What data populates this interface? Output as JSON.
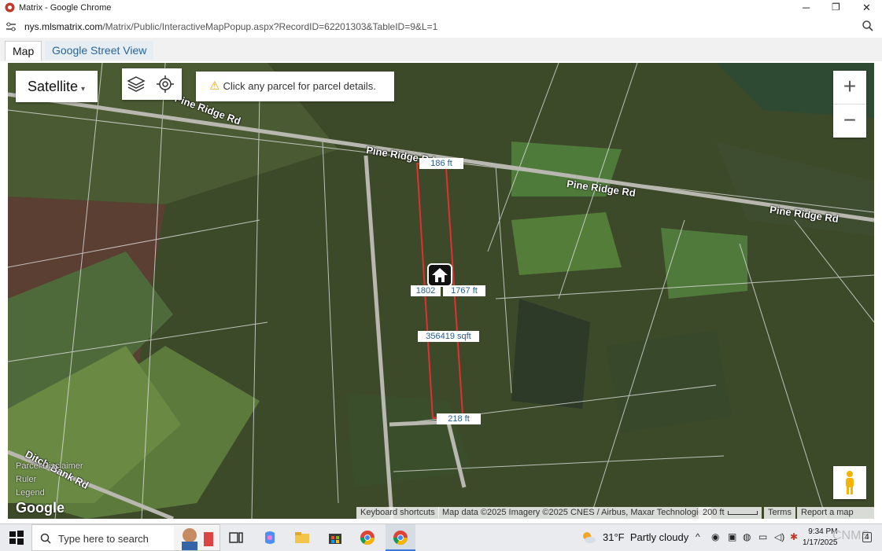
{
  "window": {
    "title": "Matrix - Google Chrome",
    "minimize": "─",
    "maximize": "❐",
    "close": "✕"
  },
  "address": {
    "host": "nys.mlsmatrix.com",
    "path": "/Matrix/Public/InteractiveMapPopup.aspx?RecordID=62201303&TableID=9&L=1"
  },
  "tabs": [
    {
      "label": "Map",
      "active": true
    },
    {
      "label": "Google Street View",
      "active": false
    }
  ],
  "map": {
    "type_control": {
      "label": "Satellite",
      "caret": "▾"
    },
    "notice": {
      "icon": "warning-icon",
      "text": "Click any parcel for parcel details."
    },
    "zoom": {
      "in": "+",
      "out": "−"
    },
    "roads": [
      "Pine Ridge Rd",
      "Pine Ridge Rd",
      "Pine Ridge Rd",
      "Ditch Bank Rd"
    ],
    "dimension_labels": {
      "top": "186 ft",
      "left_side": "1802",
      "right_side": "1767 ft",
      "area": "356419 sqft",
      "bottom": "218 ft"
    },
    "side_links": [
      "Parcel Disclaimer",
      "Ruler",
      "Legend"
    ],
    "google_logo": "Google",
    "attribution": {
      "shortcuts": "Keyboard shortcuts",
      "data": "Map data ©2025 Imagery ©2025 CNES / Airbus, Maxar Technologies",
      "scale": "200 ft",
      "terms": "Terms",
      "report": "Report a map error"
    }
  },
  "taskbar": {
    "search_placeholder": "Type here to search",
    "weather": {
      "temp": "31°F",
      "condition": "Partly cloudy"
    },
    "clock": {
      "time": "9:34 PM",
      "date": "1/17/2025"
    },
    "watermark": "CNMS",
    "notification_count": "4"
  }
}
